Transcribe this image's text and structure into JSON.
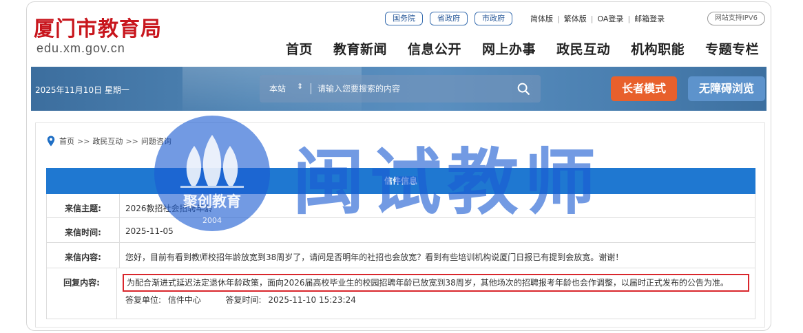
{
  "header": {
    "site_title": "厦门市教育局",
    "domain": "edu.xm.gov.cn",
    "pills": [
      "国务院",
      "省政府",
      "市政府"
    ],
    "top_links": [
      "简体版",
      "繁体版",
      "OA登录",
      "邮箱登录"
    ],
    "ipv6": "网站支持IPV6",
    "nav": [
      "首页",
      "教育新闻",
      "信息公开",
      "网上办事",
      "政民互动",
      "机构职能",
      "专题专栏"
    ]
  },
  "banner": {
    "date": "2025年11月10日 星期一",
    "search_scope": "本站",
    "search_placeholder": "请输入您要搜索的内容",
    "elder_mode": "长者模式",
    "accessible": "无障碍浏览"
  },
  "breadcrumb": [
    "首页",
    "政民互动",
    "问题咨询"
  ],
  "breadcrumb_sep": ">>",
  "letter": {
    "heading": "信件信息",
    "rows": [
      {
        "label": "来信主题:",
        "value": "2026教招社会招聘年龄"
      },
      {
        "label": "来信时间:",
        "value": "2025-11-05"
      },
      {
        "label": "来信内容:",
        "value": "您好，目前有看到教师校招年龄放宽到38周岁了，请问是否明年的社招也会放宽？看到有些培训机构说厦门日报已有提到会放宽。谢谢！"
      }
    ],
    "reply_label": "回复内容:",
    "reply_text": "为配合渐进式延迟法定退休年龄政策，面向2026届高校毕业生的校园招聘年龄已放宽到38周岁，其他场次的招聘报考年龄也会作调整，以届时正式发布的公告为准。",
    "reply_unit_label": "答复单位:",
    "reply_unit": "信件中心",
    "reply_time_label": "答复时间:",
    "reply_time": "2025-11-10 15:23:24"
  },
  "watermark": {
    "main_text": "闽试教师",
    "logo_text": "聚创教育",
    "logo_year": "2004"
  },
  "colors": {
    "title_red": "#c8161d",
    "table_head": "#1f78d1",
    "elder_btn": "#e8602c",
    "access_btn": "#5d93cc",
    "highlight_border": "#d9262c",
    "watermark_blue": "#1c5cd2"
  }
}
